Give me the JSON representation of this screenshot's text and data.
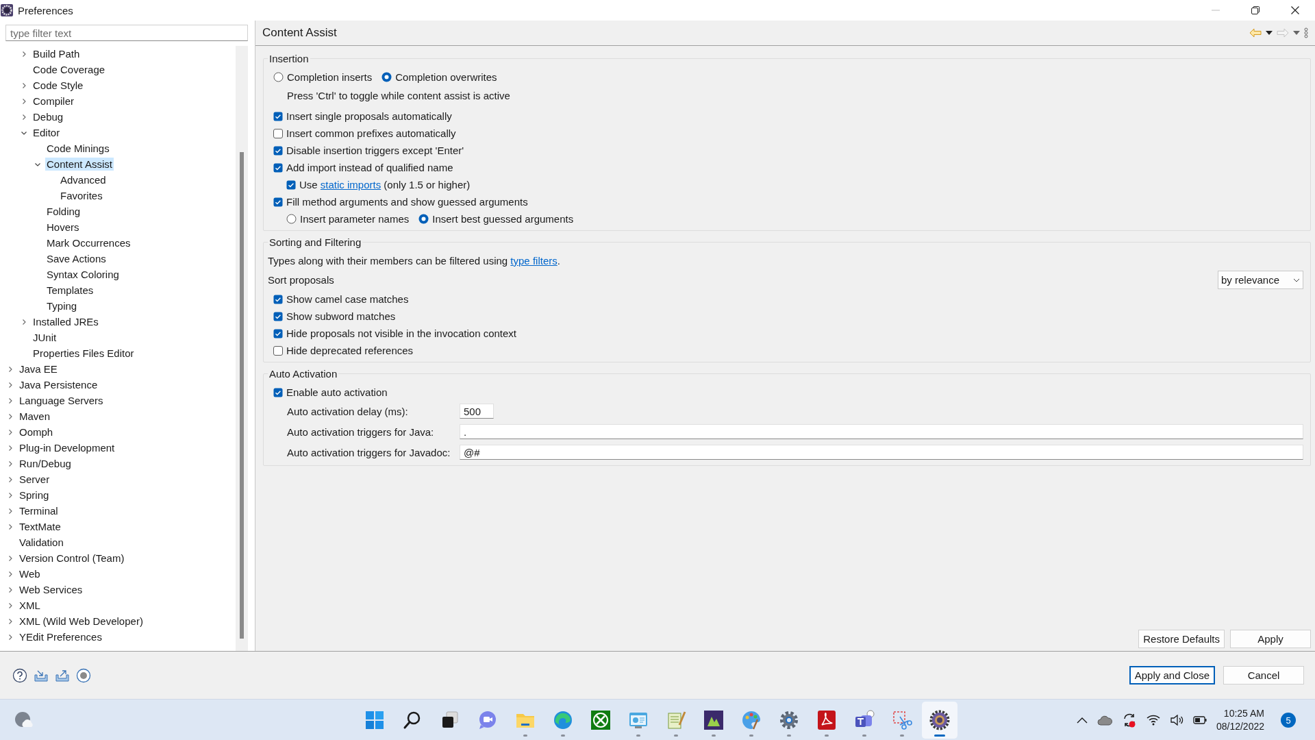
{
  "window": {
    "title": "Preferences"
  },
  "filter": {
    "placeholder": "type filter text"
  },
  "tree": {
    "continued_children": [
      {
        "label": "Build Path",
        "expanded": false,
        "selected": false
      },
      {
        "label": "Code Coverage",
        "selected": false
      },
      {
        "label": "Code Style",
        "expanded": false,
        "selected": false
      },
      {
        "label": "Compiler",
        "expanded": false,
        "selected": false
      },
      {
        "label": "Debug",
        "expanded": false,
        "selected": false
      },
      {
        "label": "Editor",
        "expanded": true,
        "selected": false,
        "children": [
          {
            "label": "Code Minings",
            "selected": false
          },
          {
            "label": "Content Assist",
            "expanded": true,
            "selected": true,
            "children": [
              {
                "label": "Advanced",
                "selected": false
              },
              {
                "label": "Favorites",
                "selected": false
              }
            ]
          },
          {
            "label": "Folding",
            "selected": false
          },
          {
            "label": "Hovers",
            "selected": false
          },
          {
            "label": "Mark Occurrences",
            "selected": false
          },
          {
            "label": "Save Actions",
            "selected": false
          },
          {
            "label": "Syntax Coloring",
            "selected": false
          },
          {
            "label": "Templates",
            "selected": false
          },
          {
            "label": "Typing",
            "selected": false
          }
        ]
      },
      {
        "label": "Installed JREs",
        "expanded": false,
        "selected": false
      },
      {
        "label": "JUnit",
        "selected": false
      },
      {
        "label": "Properties Files Editor",
        "selected": false
      }
    ],
    "items": [
      {
        "label": "Java EE",
        "expanded": false,
        "selected": false
      },
      {
        "label": "Java Persistence",
        "expanded": false,
        "selected": false
      },
      {
        "label": "Language Servers",
        "expanded": false,
        "selected": false
      },
      {
        "label": "Maven",
        "expanded": false,
        "selected": false
      },
      {
        "label": "Oomph",
        "expanded": false,
        "selected": false
      },
      {
        "label": "Plug-in Development",
        "expanded": false,
        "selected": false
      },
      {
        "label": "Run/Debug",
        "expanded": false,
        "selected": false
      },
      {
        "label": "Server",
        "expanded": false,
        "selected": false
      },
      {
        "label": "Spring",
        "expanded": false,
        "selected": false
      },
      {
        "label": "Terminal",
        "expanded": false,
        "selected": false
      },
      {
        "label": "TextMate",
        "expanded": false,
        "selected": false
      },
      {
        "label": "Validation",
        "selected": false
      },
      {
        "label": "Version Control (Team)",
        "expanded": false,
        "selected": false
      },
      {
        "label": "Web",
        "expanded": false,
        "selected": false
      },
      {
        "label": "Web Services",
        "expanded": false,
        "selected": false
      },
      {
        "label": "XML",
        "expanded": false,
        "selected": false
      },
      {
        "label": "XML (Wild Web Developer)",
        "expanded": false,
        "selected": false
      },
      {
        "label": "YEdit Preferences",
        "expanded": false,
        "selected": false
      }
    ]
  },
  "page": {
    "title": "Content Assist",
    "nav": {
      "back_enabled": true,
      "forward_enabled": false
    },
    "groups": [
      {
        "title": "Insertion",
        "rows": [
          {
            "kind": "radio-group",
            "options": [
              {
                "label": "Completion inserts",
                "selected": false
              },
              {
                "label": "Completion overwrites",
                "selected": true
              }
            ]
          },
          {
            "kind": "note",
            "text": "Press 'Ctrl' to toggle while content assist is active"
          },
          {
            "kind": "checkbox",
            "label": "Insert single proposals automatically",
            "checked": true
          },
          {
            "kind": "checkbox",
            "label": "Insert common prefixes automatically",
            "checked": false
          },
          {
            "kind": "checkbox",
            "label": "Disable insertion triggers except 'Enter'",
            "checked": true
          },
          {
            "kind": "checkbox",
            "label": "Add import instead of qualified name",
            "checked": true,
            "children": [
              {
                "kind": "checkbox-link",
                "before": "Use ",
                "link": "static imports",
                "after": " (only 1.5 or higher)",
                "checked": true
              }
            ]
          },
          {
            "kind": "checkbox",
            "label": "Fill method arguments and show guessed arguments",
            "checked": true,
            "children": [
              {
                "kind": "radio-group",
                "options": [
                  {
                    "label": "Insert parameter names",
                    "selected": false
                  },
                  {
                    "label": "Insert best guessed arguments",
                    "selected": true
                  }
                ]
              }
            ]
          }
        ]
      },
      {
        "title": "Sorting and Filtering",
        "rows": [
          {
            "kind": "text-link",
            "before": "Types along with their members can be filtered using ",
            "link": "type filters",
            "after": "."
          },
          {
            "kind": "dropdown",
            "label": "Sort proposals",
            "value": "by relevance"
          },
          {
            "kind": "checkbox",
            "label": "Show camel case matches",
            "checked": true
          },
          {
            "kind": "checkbox",
            "label": "Show subword matches",
            "checked": true
          },
          {
            "kind": "checkbox",
            "label": "Hide proposals not visible in the invocation context",
            "checked": true
          },
          {
            "kind": "checkbox",
            "label": "Hide deprecated references",
            "checked": false
          }
        ]
      },
      {
        "title": "Auto Activation",
        "rows": [
          {
            "kind": "checkbox",
            "label": "Enable auto activation",
            "checked": true
          },
          {
            "kind": "short-field",
            "label": "Auto activation delay (ms):",
            "value": "500"
          },
          {
            "kind": "field",
            "label": "Auto activation triggers for Java:",
            "value": "."
          },
          {
            "kind": "field",
            "label": "Auto activation triggers for Javadoc:",
            "value": "@#"
          }
        ]
      }
    ],
    "buttons": [
      {
        "label": "Restore Defaults"
      },
      {
        "label": "Apply"
      }
    ]
  },
  "dialog_buttons": [
    {
      "label": "Apply and Close",
      "default": true
    },
    {
      "label": "Cancel",
      "default": false
    }
  ],
  "taskbar": {
    "apps": [
      {
        "running": false,
        "active": false
      },
      {
        "running": false,
        "active": false
      },
      {
        "running": false,
        "active": false
      },
      {
        "running": false,
        "active": false
      },
      {
        "running": true,
        "active": false
      },
      {
        "running": true,
        "active": false
      },
      {
        "running": false,
        "active": false
      },
      {
        "running": true,
        "active": false
      },
      {
        "running": true,
        "active": false
      },
      {
        "running": true,
        "active": false
      },
      {
        "running": true,
        "active": false
      },
      {
        "running": true,
        "active": false
      },
      {
        "running": true,
        "active": false
      },
      {
        "running": true,
        "active": false
      },
      {
        "running": true,
        "active": false
      },
      {
        "running": true,
        "active": true
      }
    ],
    "clock": {
      "time": "10:25 AM",
      "date": "08/12/2022"
    },
    "notifications": "5"
  }
}
